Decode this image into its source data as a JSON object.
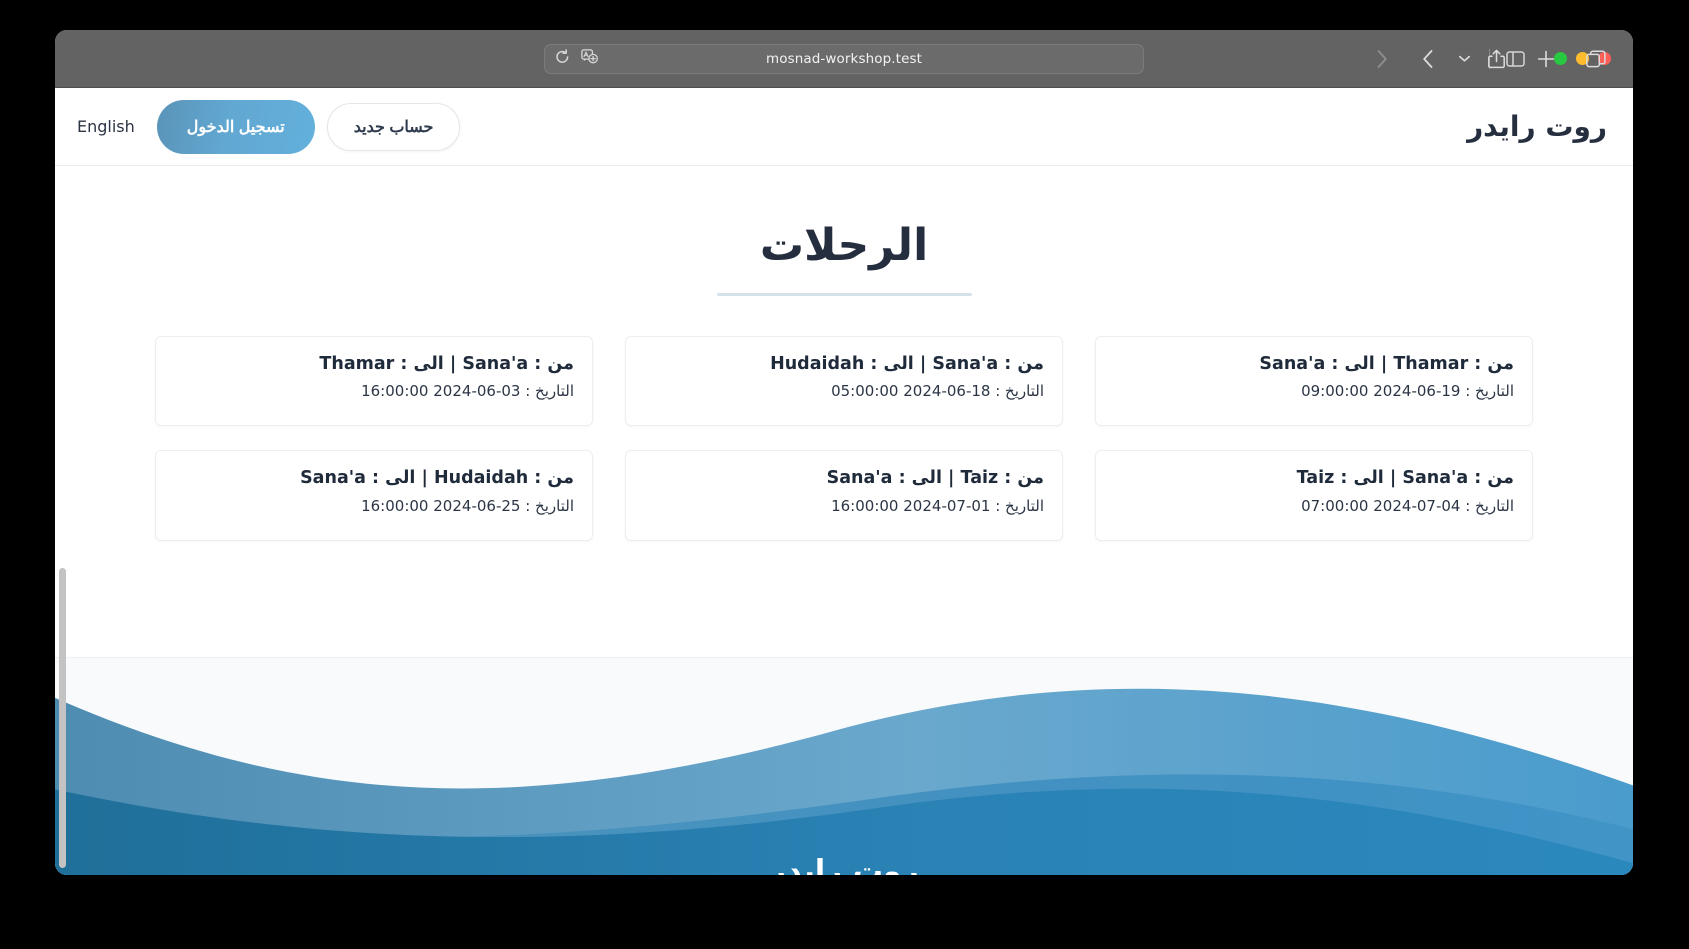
{
  "browser": {
    "url": "mosnad-workshop.test",
    "traffic_lights": [
      "close",
      "minimize",
      "zoom"
    ],
    "toolbar_left": [
      {
        "name": "sidebar-toggle",
        "label": "Sidebar"
      },
      {
        "name": "sidebar-dropdown",
        "label": "Sidebar options"
      },
      {
        "name": "back-button",
        "label": "Back"
      },
      {
        "name": "forward-button",
        "label": "Forward"
      }
    ],
    "address_icons": [
      {
        "name": "translate-icon",
        "label": "Translate"
      },
      {
        "name": "reload-icon",
        "label": "Reload"
      }
    ],
    "toolbar_right": [
      {
        "name": "share-icon",
        "label": "Share"
      },
      {
        "name": "new-tab-icon",
        "label": "New Tab"
      },
      {
        "name": "tab-overview-icon",
        "label": "Tab Overview"
      }
    ]
  },
  "site": {
    "brand": "روت رايدر",
    "nav": {
      "new_account": "حساب جديد",
      "login": "تسجيل الدخول",
      "language": "English"
    },
    "page_title": "الرحلات",
    "footer_text": "روت رايدر"
  },
  "trips": [
    {
      "route": "من : Sana'a | الى : Thamar",
      "date": "التاريخ : 03-06-2024 16:00:00"
    },
    {
      "route": "من : Sana'a | الى : Hudaidah",
      "date": "التاريخ : 18-06-2024 05:00:00"
    },
    {
      "route": "من : Thamar | الى : Sana'a",
      "date": "التاريخ : 19-06-2024 09:00:00"
    },
    {
      "route": "من : Hudaidah | الى : Sana'a",
      "date": "التاريخ : 25-06-2024 16:00:00"
    },
    {
      "route": "من : Taiz | الى : Sana'a",
      "date": "التاريخ : 01-07-2024 16:00:00"
    },
    {
      "route": "من : Sana'a | الى : Taiz",
      "date": "التاريخ : 04-07-2024 07:00:00"
    }
  ],
  "colors": {
    "accent": "#63b0dc",
    "login_gradient_start": "#5b93b8",
    "login_gradient_end": "#63b0dc",
    "heading": "#242e3e",
    "wave_light": "#5b9dc4",
    "wave_mid": "#3f8cb8",
    "wave_deep": "#2a82b5",
    "titlebar": "#636363"
  }
}
